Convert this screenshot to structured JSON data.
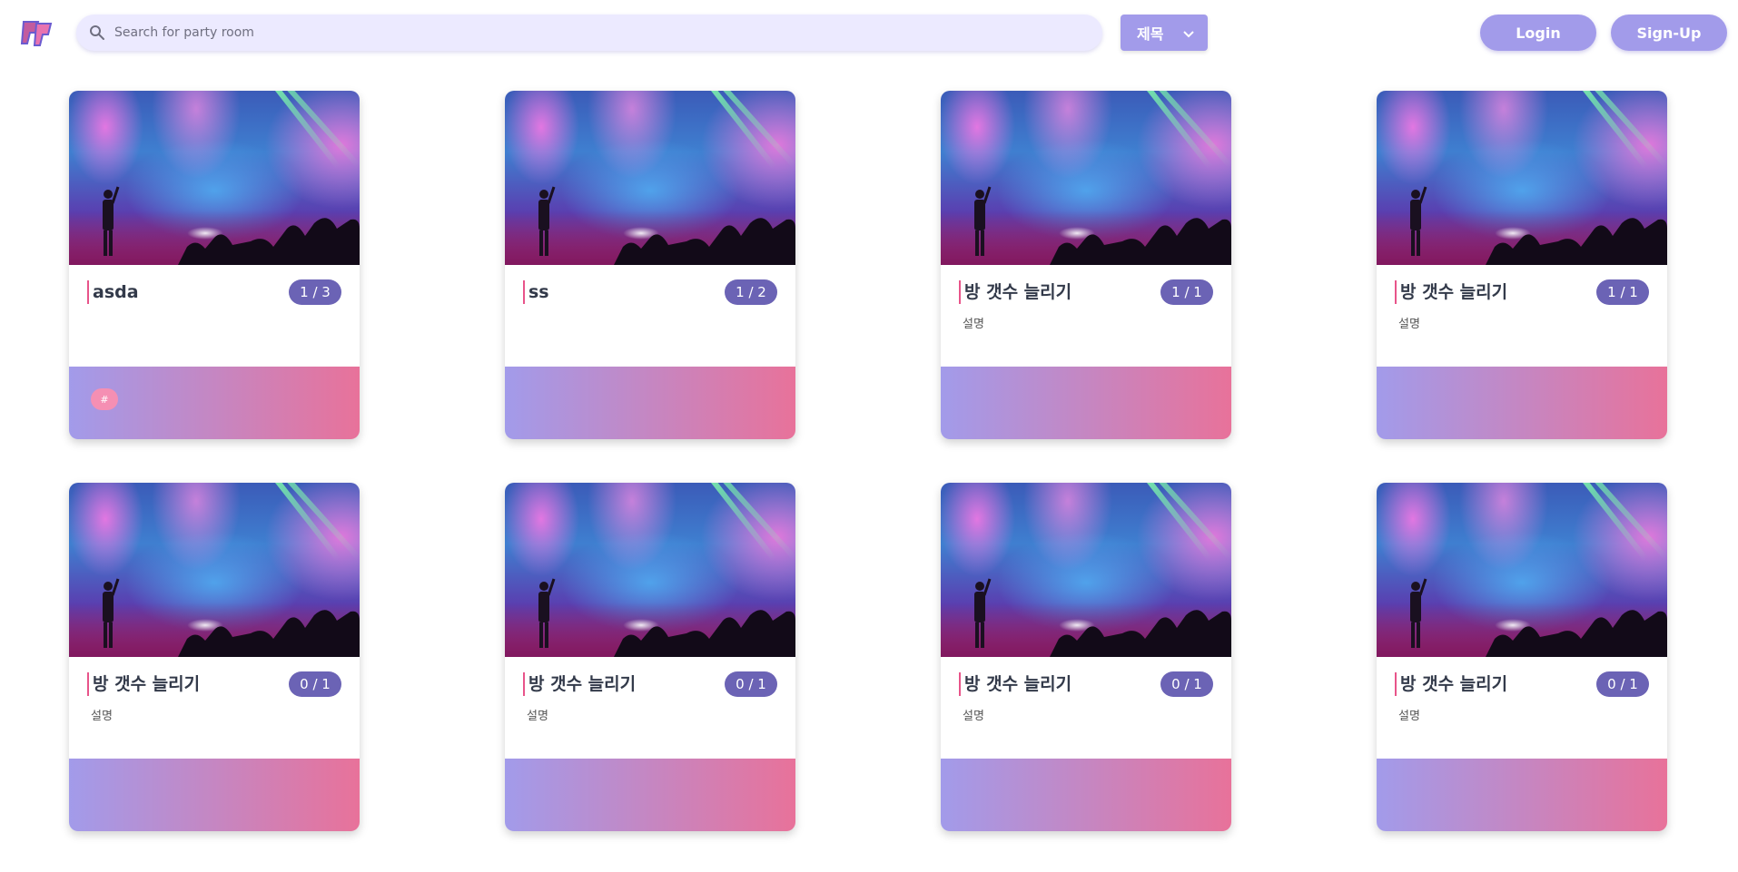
{
  "header": {
    "logo_name": "party-logo",
    "search": {
      "placeholder": "Search for party room",
      "value": ""
    },
    "filter": {
      "selected": "제목"
    },
    "login_label": "Login",
    "signup_label": "Sign-Up"
  },
  "colors": {
    "accent": "#a29bea",
    "badge": "#6b63b5",
    "title_bar": "#e8548a",
    "footer_start": "#a29bea",
    "footer_end": "#e8729a",
    "tag": "#f58fb3"
  },
  "rooms": [
    {
      "title": "asda",
      "count": "1 / 3",
      "desc": "",
      "tag": "#"
    },
    {
      "title": "ss",
      "count": "1 / 2",
      "desc": ""
    },
    {
      "title": "방 갯수 늘리기",
      "count": "1 / 1",
      "desc": "설명"
    },
    {
      "title": "방 갯수 늘리기",
      "count": "1 / 1",
      "desc": "설명"
    },
    {
      "title": "방 갯수 늘리기",
      "count": "0 / 1",
      "desc": "설명"
    },
    {
      "title": "방 갯수 늘리기",
      "count": "0 / 1",
      "desc": "설명"
    },
    {
      "title": "방 갯수 늘리기",
      "count": "0 / 1",
      "desc": "설명"
    },
    {
      "title": "방 갯수 늘리기",
      "count": "0 / 1",
      "desc": "설명"
    }
  ]
}
